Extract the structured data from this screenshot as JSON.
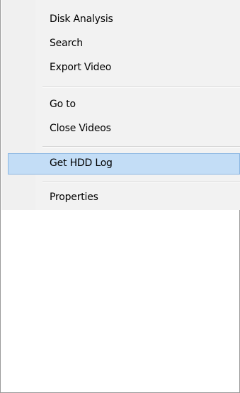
{
  "menu": {
    "items": [
      {
        "label": "Disk Analysis"
      },
      {
        "label": "Search"
      },
      {
        "label": "Export Video"
      },
      {
        "label": "Go to"
      },
      {
        "label": "Close Videos"
      },
      {
        "label": "Get HDD Log"
      },
      {
        "label": "Properties"
      }
    ],
    "highlighted_item": "Get HDD Log",
    "highlight_color": "#c3ddf6",
    "highlight_border_color": "#8ab6e2"
  }
}
